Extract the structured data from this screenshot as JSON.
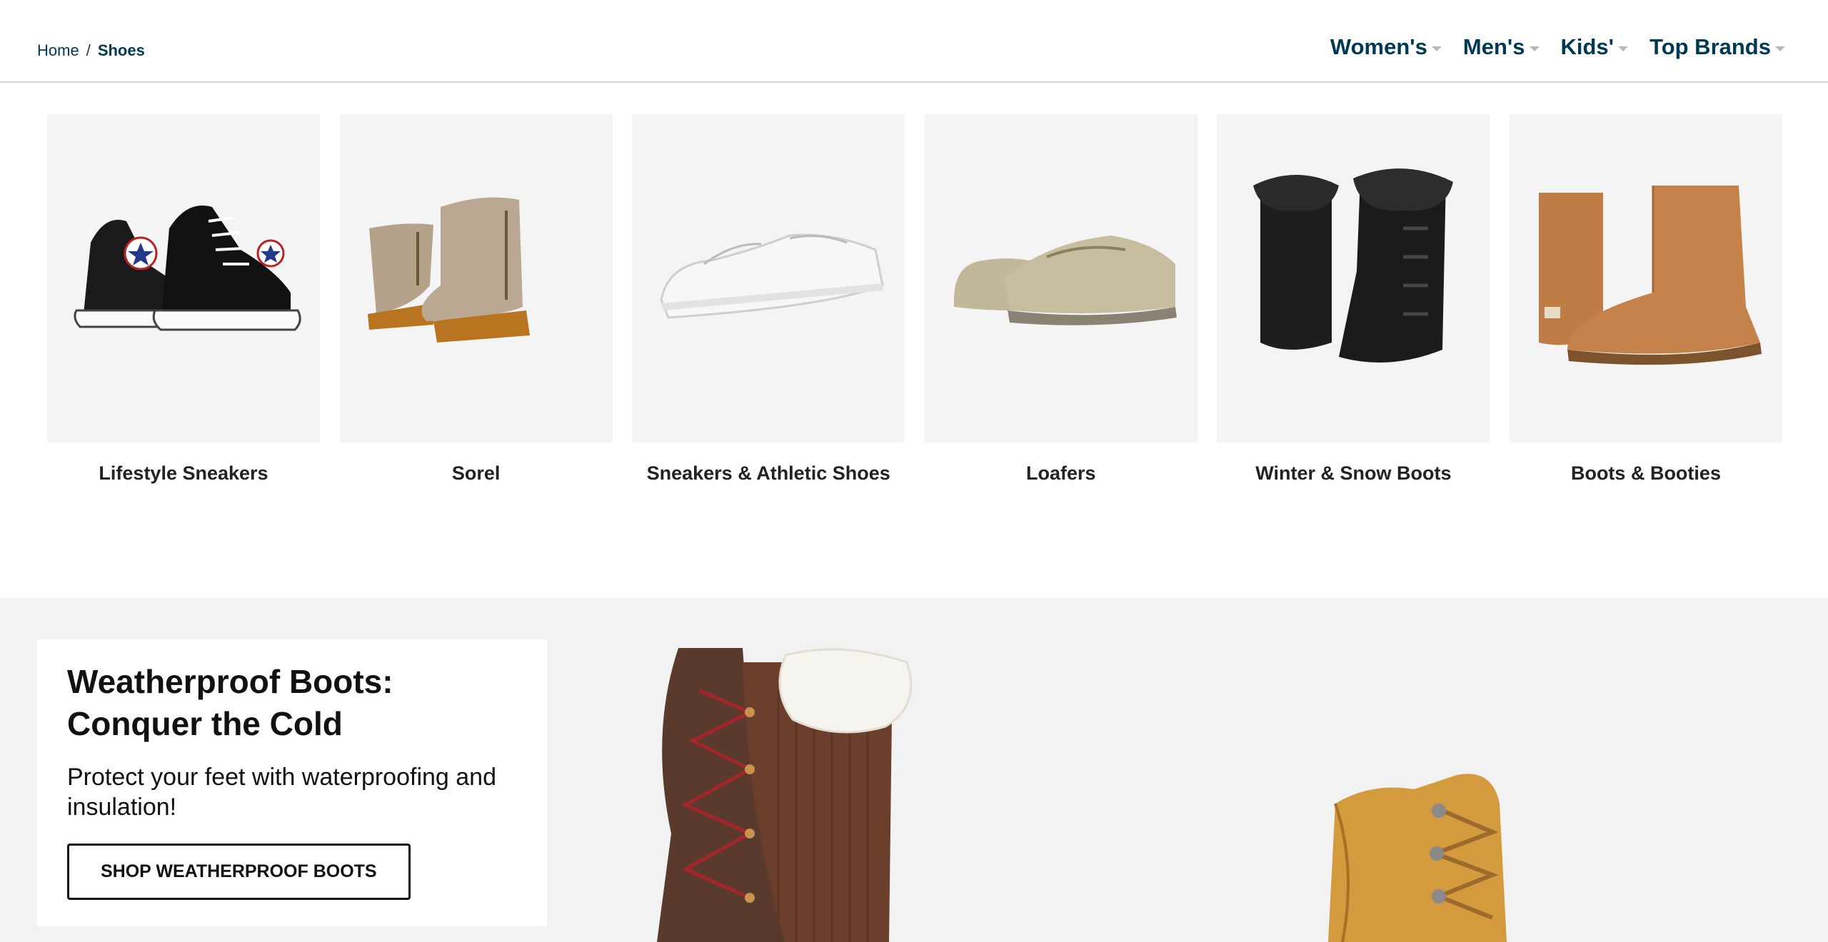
{
  "breadcrumb": {
    "home": "Home",
    "separator": "/",
    "current": "Shoes"
  },
  "nav": [
    {
      "label": "Women's"
    },
    {
      "label": "Men's"
    },
    {
      "label": "Kids'"
    },
    {
      "label": "Top Brands"
    }
  ],
  "tiles": [
    {
      "label": "Lifestyle Sneakers",
      "icon": "high-top-sneaker-image"
    },
    {
      "label": "Sorel",
      "icon": "wedge-bootie-image"
    },
    {
      "label": "Sneakers & Athletic Shoes",
      "icon": "slip-on-sneaker-image"
    },
    {
      "label": "Loafers",
      "icon": "loafer-image"
    },
    {
      "label": "Winter & Snow Boots",
      "icon": "snow-boot-image"
    },
    {
      "label": "Boots & Booties",
      "icon": "shearling-boot-image"
    }
  ],
  "banner": {
    "title": "Weatherproof Boots: Conquer the Cold",
    "text": "Protect your feet with waterproofing and insulation!",
    "button": "SHOP WEATHERPROOF BOOTS"
  },
  "colors": {
    "nav_text": "#003953",
    "tile_bg": "#f4f4f4",
    "banner_bg": "#f2f2f2"
  }
}
